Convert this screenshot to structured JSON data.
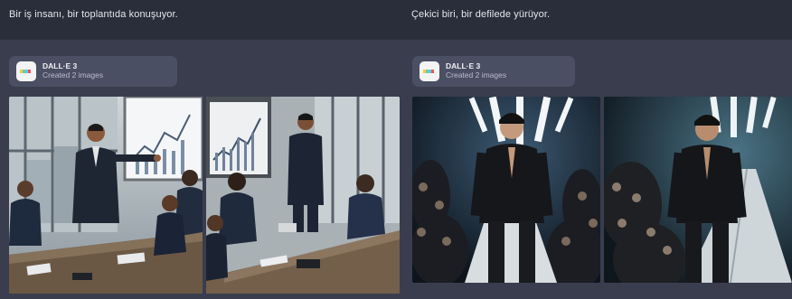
{
  "left": {
    "prompt": "Bir iş insanı, bir toplantıda konuşuyor.",
    "card": {
      "title": "DALL·E 3",
      "subtitle": "Created 2 images"
    },
    "images": [
      {
        "icon": "business-meeting-image-1"
      },
      {
        "icon": "business-meeting-image-2"
      }
    ]
  },
  "right": {
    "prompt": "Çekici biri, bir defilede yürüyor.",
    "card": {
      "title": "DALL·E 3",
      "subtitle": "Created 2 images"
    },
    "images": [
      {
        "icon": "runway-model-image-1"
      },
      {
        "icon": "runway-model-image-2"
      }
    ]
  },
  "colors": {
    "background": "#3a3d4e",
    "prompt_bar": "#2a2d3a",
    "card": "#4b4f63"
  }
}
